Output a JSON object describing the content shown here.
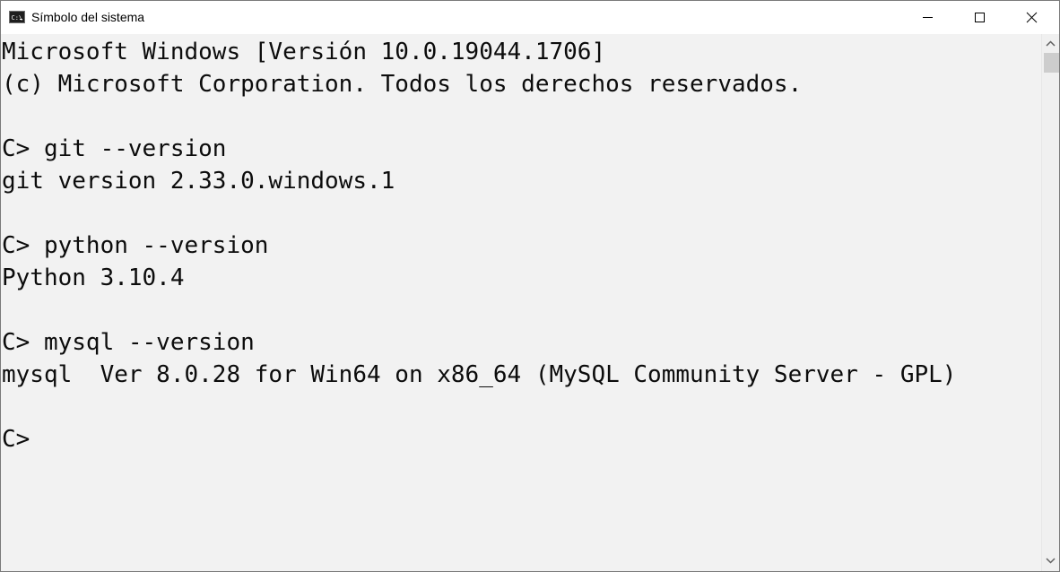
{
  "window": {
    "title": "Símbolo del sistema",
    "icon": "console-icon"
  },
  "caption_buttons": {
    "minimize_icon": "minimize-icon",
    "maximize_icon": "maximize-icon",
    "close_icon": "close-icon"
  },
  "console": {
    "lines": [
      "Microsoft Windows [Versión 10.0.19044.1706]",
      "(c) Microsoft Corporation. Todos los derechos reservados.",
      "",
      "C> git --version",
      "git version 2.33.0.windows.1",
      "",
      "C> python --version",
      "Python 3.10.4",
      "",
      "C> mysql --version",
      "mysql  Ver 8.0.28 for Win64 on x86_64 (MySQL Community Server - GPL)",
      "",
      "C>"
    ],
    "background": "#f2f2f2",
    "foreground": "#0c0c0c"
  },
  "scrollbar": {
    "up_icon": "chevron-up-icon",
    "down_icon": "chevron-down-icon"
  }
}
